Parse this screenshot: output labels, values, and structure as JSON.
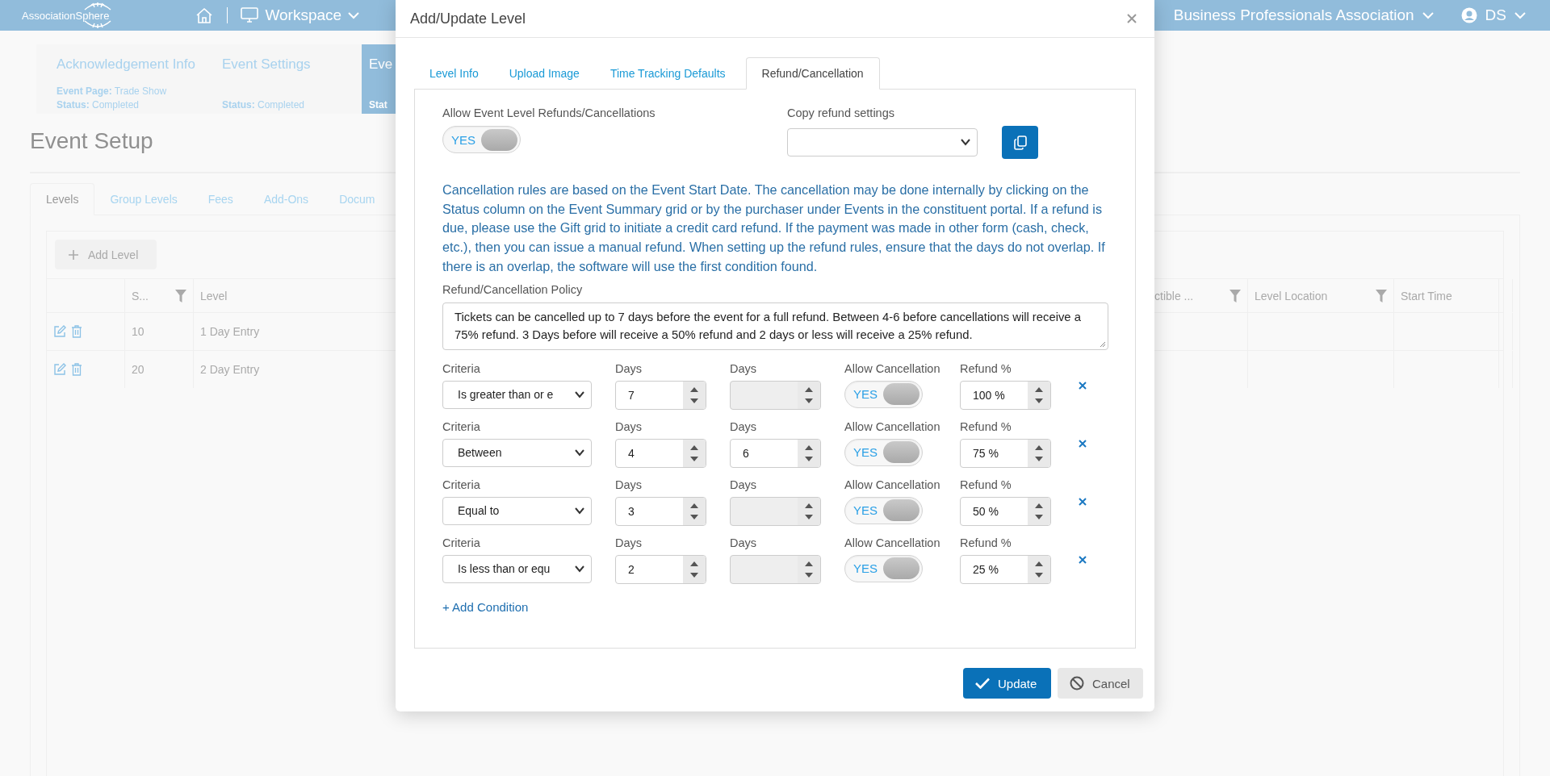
{
  "header": {
    "logo": "AssociationSphere",
    "workspace": "Workspace",
    "organization": "Business Professionals Association",
    "user": "DS"
  },
  "steps": [
    {
      "title": "Acknowledgement Info",
      "selected": false,
      "details": [
        {
          "label": "Event Page:",
          "value": "Trade Show"
        },
        {
          "label": "Status:",
          "value": "Completed"
        }
      ]
    },
    {
      "title": "Event Settings",
      "selected": false,
      "details": [
        {
          "label": "Status:",
          "value": "Completed"
        }
      ]
    },
    {
      "title": "Eve",
      "selected": true,
      "details": [
        {
          "label": "Stat"
        }
      ]
    }
  ],
  "page_title": "Event Setup",
  "tabs": [
    {
      "label": "Levels",
      "selected": true
    },
    {
      "label": "Group Levels",
      "selected": false
    },
    {
      "label": "Fees",
      "selected": false
    },
    {
      "label": "Add-Ons",
      "selected": false
    },
    {
      "label": "Docum",
      "selected": false
    }
  ],
  "add_button": "Add Level",
  "table": {
    "columns": [
      {
        "label": "S...",
        "filter": true
      },
      {
        "label": "Level"
      },
      {
        "label": "ctible ...",
        "filter": true
      },
      {
        "label": "Level Location",
        "filter": true
      },
      {
        "label": "Start Time",
        "filter": false
      }
    ],
    "rows": [
      {
        "cells": [
          "10",
          "1 Day Entry"
        ]
      },
      {
        "cells": [
          "20",
          "2 Day Entry"
        ]
      }
    ]
  },
  "dialog": {
    "title": "Add/Update Level",
    "tabs": [
      {
        "label": "Level Info",
        "selected": false
      },
      {
        "label": "Upload Image",
        "selected": false
      },
      {
        "label": "Time Tracking Defaults",
        "selected": false
      },
      {
        "label": "Refund/Cancellation",
        "selected": true
      }
    ],
    "allow_label": "Allow Event Level Refunds/Cancellations",
    "allow_toggle": {
      "label": "YES",
      "on": true
    },
    "copy_label": "Copy refund settings",
    "info": "Cancellation rules are based on the Event Start Date. The cancellation may be done internally by clicking on the Status column on the Event Summary grid or by the purchaser under Events in the constituent portal. If a refund is due, please use the Gift grid to initiate a credit card refund. If the payment was made in other form (cash, check, etc.), then you can issue a manual refund. When setting up the refund rules, ensure that the days do not overlap. If there is an overlap, the software will use the first condition found.",
    "policy_label": "Refund/Cancellation Policy",
    "policy": "Tickets can be cancelled up to 7 days before the event for a full refund. Between 4-6 before cancellations will receive a 75% refund. 3 Days before will receive a 50% refund and 2 days or less will receive a 25% refund.",
    "conditions": [
      {
        "criteria_label": "Criteria",
        "criteria": "Is greater than or e",
        "days_label": "Days",
        "days": "7",
        "days2_label": "Days",
        "days2_disabled": true,
        "allow_label": "Allow Cancellation",
        "allow": {
          "label": "YES",
          "on": true
        },
        "refund_label": "Refund %",
        "refund": "100 %"
      },
      {
        "criteria_label": "Criteria",
        "criteria": "Between",
        "days_label": "Days",
        "days": "4",
        "days2_label": "Days",
        "days2": "6",
        "days2_disabled": false,
        "allow_label": "Allow Cancellation",
        "allow": {
          "label": "YES",
          "on": true
        },
        "refund_label": "Refund %",
        "refund": "75 %"
      },
      {
        "criteria_label": "Criteria",
        "criteria": "Equal to",
        "days_label": "Days",
        "days": "3",
        "days2_label": "Days",
        "days2_disabled": true,
        "allow_label": "Allow Cancellation",
        "allow": {
          "label": "YES",
          "on": true
        },
        "refund_label": "Refund %",
        "refund": "50 %"
      },
      {
        "criteria_label": "Criteria",
        "criteria": "Is less than or equ",
        "days_label": "Days",
        "days": "2",
        "days2_label": "Days",
        "days2_disabled": true,
        "allow_label": "Allow Cancellation",
        "allow": {
          "label": "YES",
          "on": true
        },
        "refund_label": "Refund %",
        "refund": "25 %"
      }
    ],
    "add_condition": "+ Add Condition",
    "buttons": [
      {
        "label": "Update",
        "kind": "primary"
      },
      {
        "label": "Cancel",
        "kind": "secondary"
      }
    ]
  }
}
